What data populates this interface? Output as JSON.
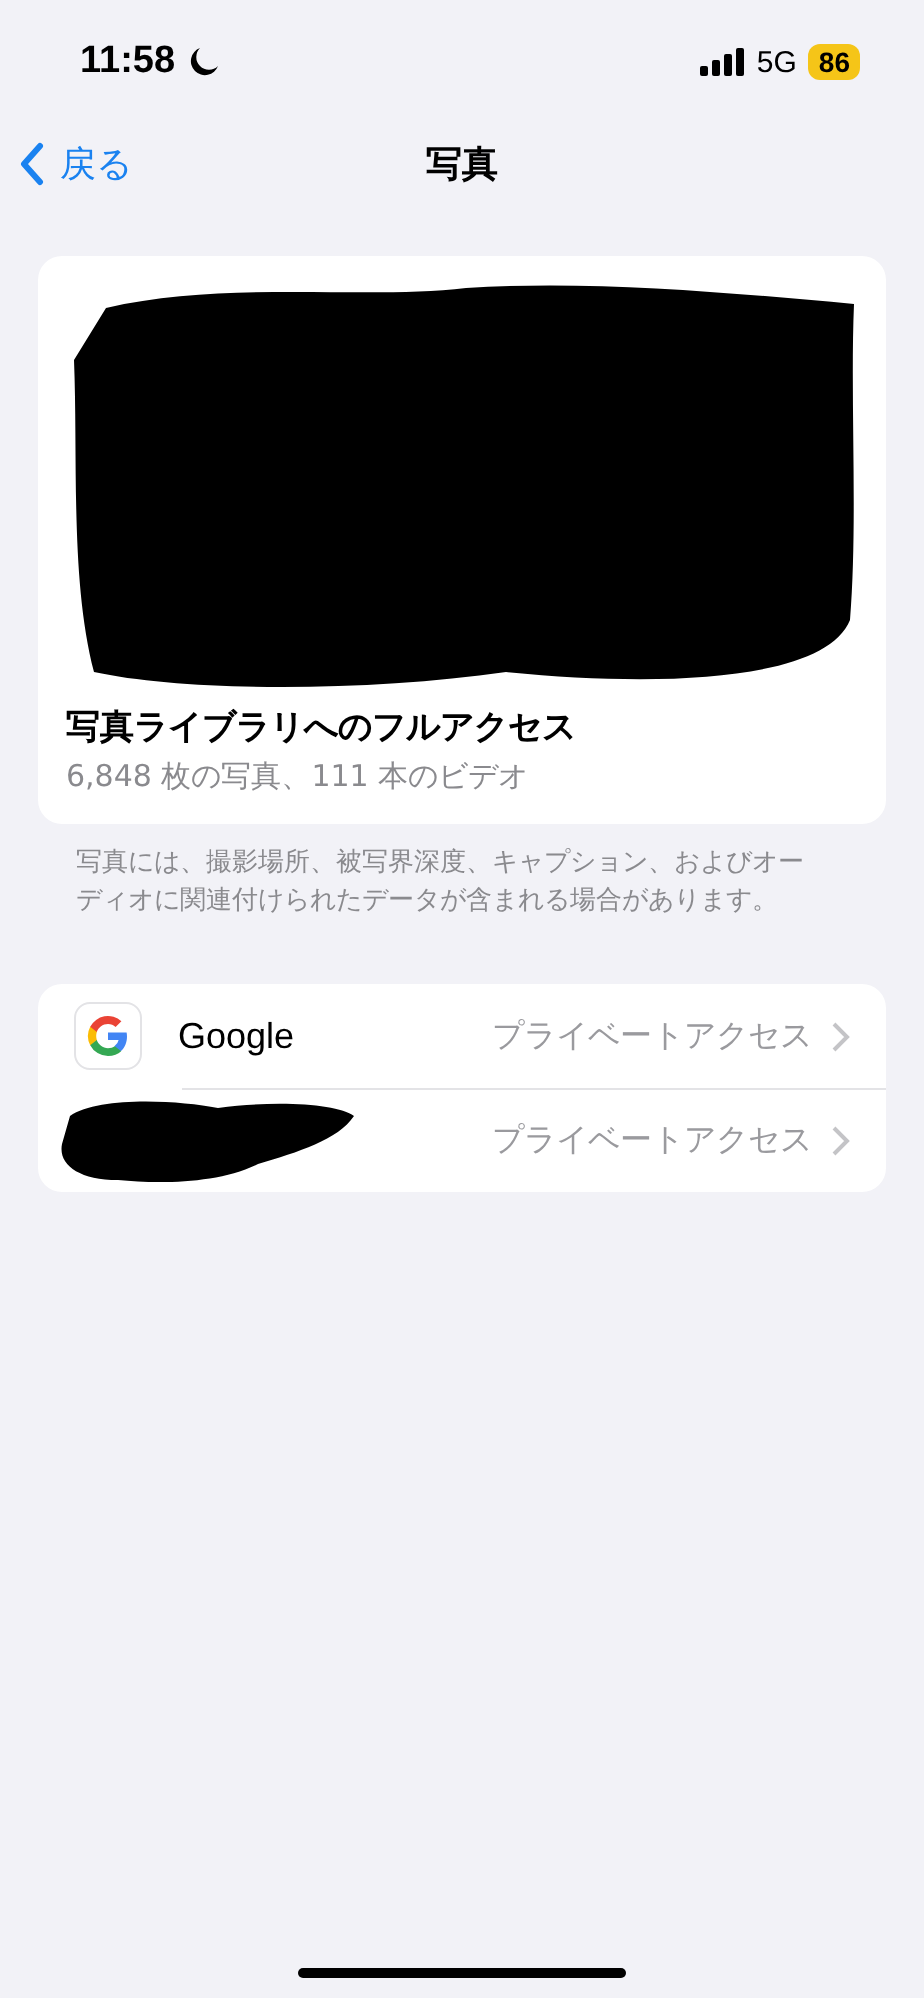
{
  "status_bar": {
    "time": "11:58",
    "network": "5G",
    "battery": "86"
  },
  "nav": {
    "back": "戻る",
    "title": "写真"
  },
  "library": {
    "title": "写真ライブラリへのフルアクセス",
    "subtitle": "6,848 枚の写真、111 本のビデオ"
  },
  "footnote": "写真には、撮影場所、被写界深度、キャプション、およびオーディオに関連付けられたデータが含まれる場合があります。",
  "apps": [
    {
      "kind": "app",
      "name": "Google",
      "access": "プライベートアクセス"
    },
    {
      "kind": "redacted",
      "access": "プライベートアクセス"
    }
  ]
}
